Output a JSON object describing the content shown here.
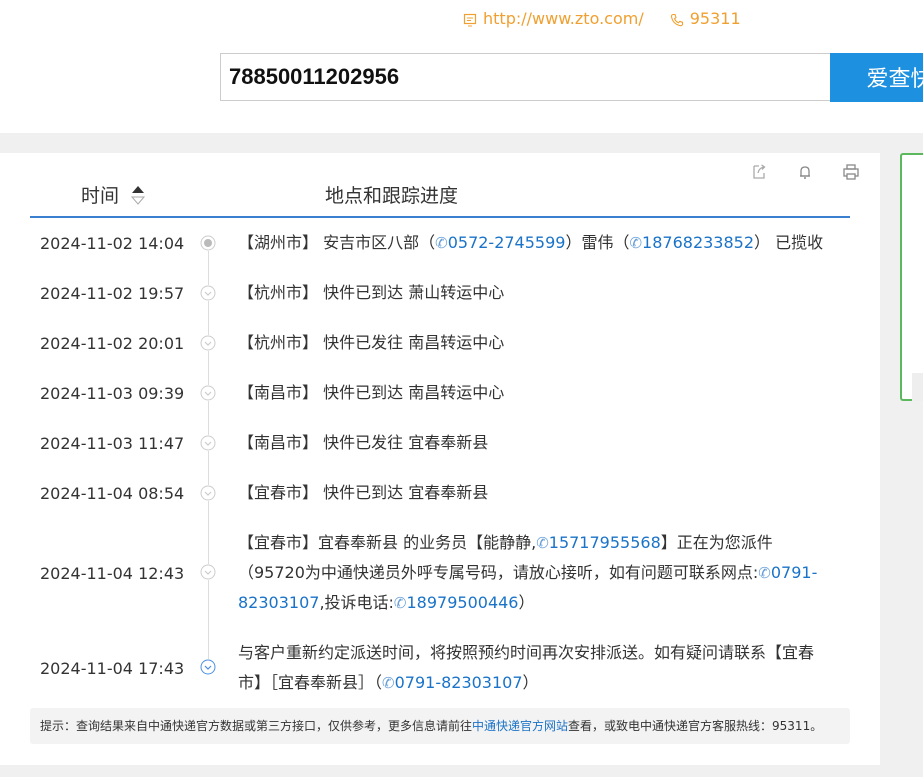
{
  "header": {
    "website": "http://www.zto.com/",
    "hotline": "95311"
  },
  "search": {
    "value": "78850011202956",
    "button_label": "爱查快"
  },
  "table": {
    "col_time": "时间",
    "col_location": "地点和跟踪进度"
  },
  "tracking": [
    {
      "time": "2024-11-02 14:04",
      "city": "【湖州市】",
      "text": "安吉市区八部（",
      "tel1": "0572-2745599",
      "mid": "）雷伟（",
      "tel2": "18768233852",
      "tail": "） 已揽收"
    },
    {
      "time": "2024-11-02 19:57",
      "city": "【杭州市】",
      "text": "快件已到达 萧山转运中心"
    },
    {
      "time": "2024-11-02 20:01",
      "city": "【杭州市】",
      "text": "快件已发往 南昌转运中心"
    },
    {
      "time": "2024-11-03 09:39",
      "city": "【南昌市】",
      "text": "快件已到达 南昌转运中心"
    },
    {
      "time": "2024-11-03 11:47",
      "city": "【南昌市】",
      "text": "快件已发往 宜春奉新县"
    },
    {
      "time": "2024-11-04 08:54",
      "city": "【宜春市】",
      "text": "快件已到达 宜春奉新县"
    },
    {
      "time": "2024-11-04 12:43",
      "p1": "【宜春市】宜春奉新县 的业务员【能静静,",
      "tel1": "15717955568",
      "p2": "】正在为您派件（95720为中通快递员外呼专属号码，请放心接听，如有问题可联系网点:",
      "tel2": "0791-82303107",
      "p3": ",投诉电话:",
      "tel3": "18979500446",
      "p4": "）"
    },
    {
      "time": "2024-11-04 17:43",
      "p1": "与客户重新约定派送时间，将按照预约时间再次安排派送。如有疑问请联系【宜春市】［宜春奉新县］（",
      "tel1": "0791-82303107",
      "p2": "）"
    }
  ],
  "note": {
    "prefix": "提示：查询结果来自中通快递官方数据或第三方接口，仅供参考，更多信息请前往",
    "link": "中通快递官方网站",
    "suffix": "查看，或致电中通快递官方客服热线：95311。"
  },
  "colors": {
    "accent_blue": "#1e90e0",
    "link_blue": "#1a73c8",
    "header_orange": "#f0a030",
    "side_green": "#5cb85c"
  }
}
